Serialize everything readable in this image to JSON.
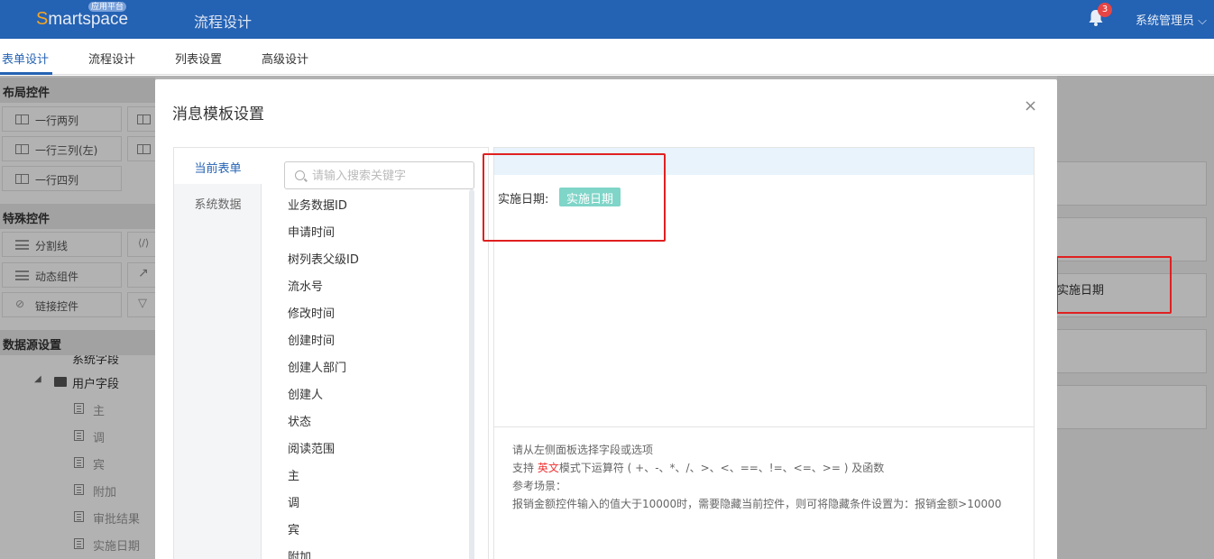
{
  "header": {
    "logo_s": "S",
    "logo_rest": "martspace",
    "logo_tag": "应用平台",
    "title": "流程设计",
    "notifications": "3",
    "user": "系统管理员"
  },
  "subnav": {
    "tabs": [
      "表单设计",
      "流程设计",
      "列表设置",
      "高级设计"
    ]
  },
  "left_panel": {
    "layout_title": "布局控件",
    "layout_items": [
      "一行两列",
      "一行三列(左)",
      "一行四列"
    ],
    "special_title": "特殊控件",
    "special_items": [
      "分割线",
      "动态组件",
      "链接控件"
    ],
    "datasource_title": "数据源设置",
    "tree_partial": "系统字段",
    "tree_folder": "用户字段",
    "tree_fields": [
      "主",
      "调",
      "宾",
      "附加",
      "审批结果",
      "实施日期"
    ]
  },
  "right_panel": {
    "field_text": "实施日期"
  },
  "modal": {
    "title": "消息模板设置",
    "close": "×",
    "tabs": [
      "当前表单",
      "系统数据"
    ],
    "search_placeholder": "请输入搜索关键字",
    "fields": [
      "业务数据ID",
      "申请时间",
      "树列表父级ID",
      "流水号",
      "修改时间",
      "创建时间",
      "创建人部门",
      "创建人",
      "状态",
      "阅读范围",
      "主",
      "调",
      "宾",
      "附加"
    ],
    "editor_label": "实施日期:",
    "editor_chip": "实施日期",
    "help_line1": "请从左侧面板选择字段或选项",
    "help_line2_pre": "支持 ",
    "help_line2_red": "英文",
    "help_line2_post": "模式下运算符 ( +、-、*、/、>、<、==、!=、<=、>= ) 及函数",
    "help_line3": "参考场景：",
    "help_line4": "报销金额控件输入的值大于10000时，需要隐藏当前控件，则可将隐藏条件设置为：报销金额>10000"
  },
  "colors": {
    "brand": "#2462b3",
    "chip": "#7fd5c8",
    "highlight": "#e02020"
  }
}
